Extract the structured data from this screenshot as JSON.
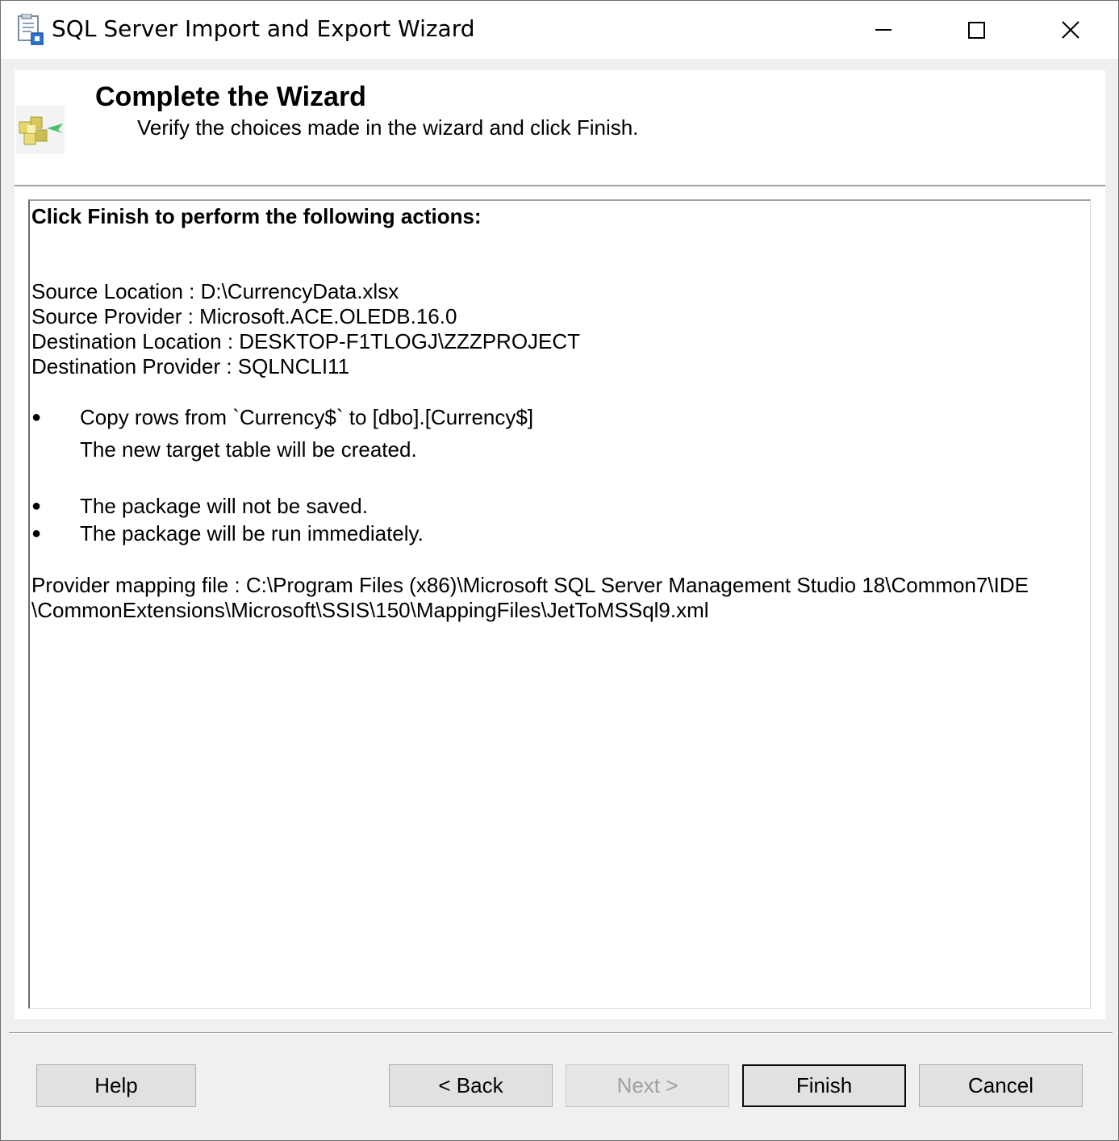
{
  "window": {
    "title": "SQL Server Import and Export Wizard"
  },
  "header": {
    "title": "Complete the Wizard",
    "subtitle": "Verify the choices made in the wizard and click Finish."
  },
  "summary": {
    "heading": "Click Finish to perform the following actions:",
    "source_location": "Source Location : D:\\CurrencyData.xlsx",
    "source_provider": "Source Provider : Microsoft.ACE.OLEDB.16.0",
    "destination_location": "Destination Location : DESKTOP-F1TLOGJ\\ZZZPROJECT",
    "destination_provider": "Destination Provider : SQLNCLI11",
    "actions": [
      {
        "bullet": "●",
        "text": "Copy rows from `Currency$` to [dbo].[Currency$]",
        "detail": "The new target table will be created."
      },
      {
        "bullet": "●",
        "text": "The package will not be saved."
      },
      {
        "bullet": "●",
        "text": "The package will be run immediately."
      }
    ],
    "mapping_line1": "Provider mapping file : C:\\Program Files (x86)\\Microsoft SQL Server Management Studio 18\\Common7\\IDE",
    "mapping_line2": "\\CommonExtensions\\Microsoft\\SSIS\\150\\MappingFiles\\JetToMSSql9.xml"
  },
  "buttons": {
    "help": "Help",
    "back": "< Back",
    "next": "Next >",
    "finish": "Finish",
    "cancel": "Cancel"
  },
  "icons": {
    "app": "wizard-app-icon",
    "header": "package-wizard-icon",
    "minimize": "minimize-icon",
    "maximize": "maximize-icon",
    "close": "close-icon"
  }
}
